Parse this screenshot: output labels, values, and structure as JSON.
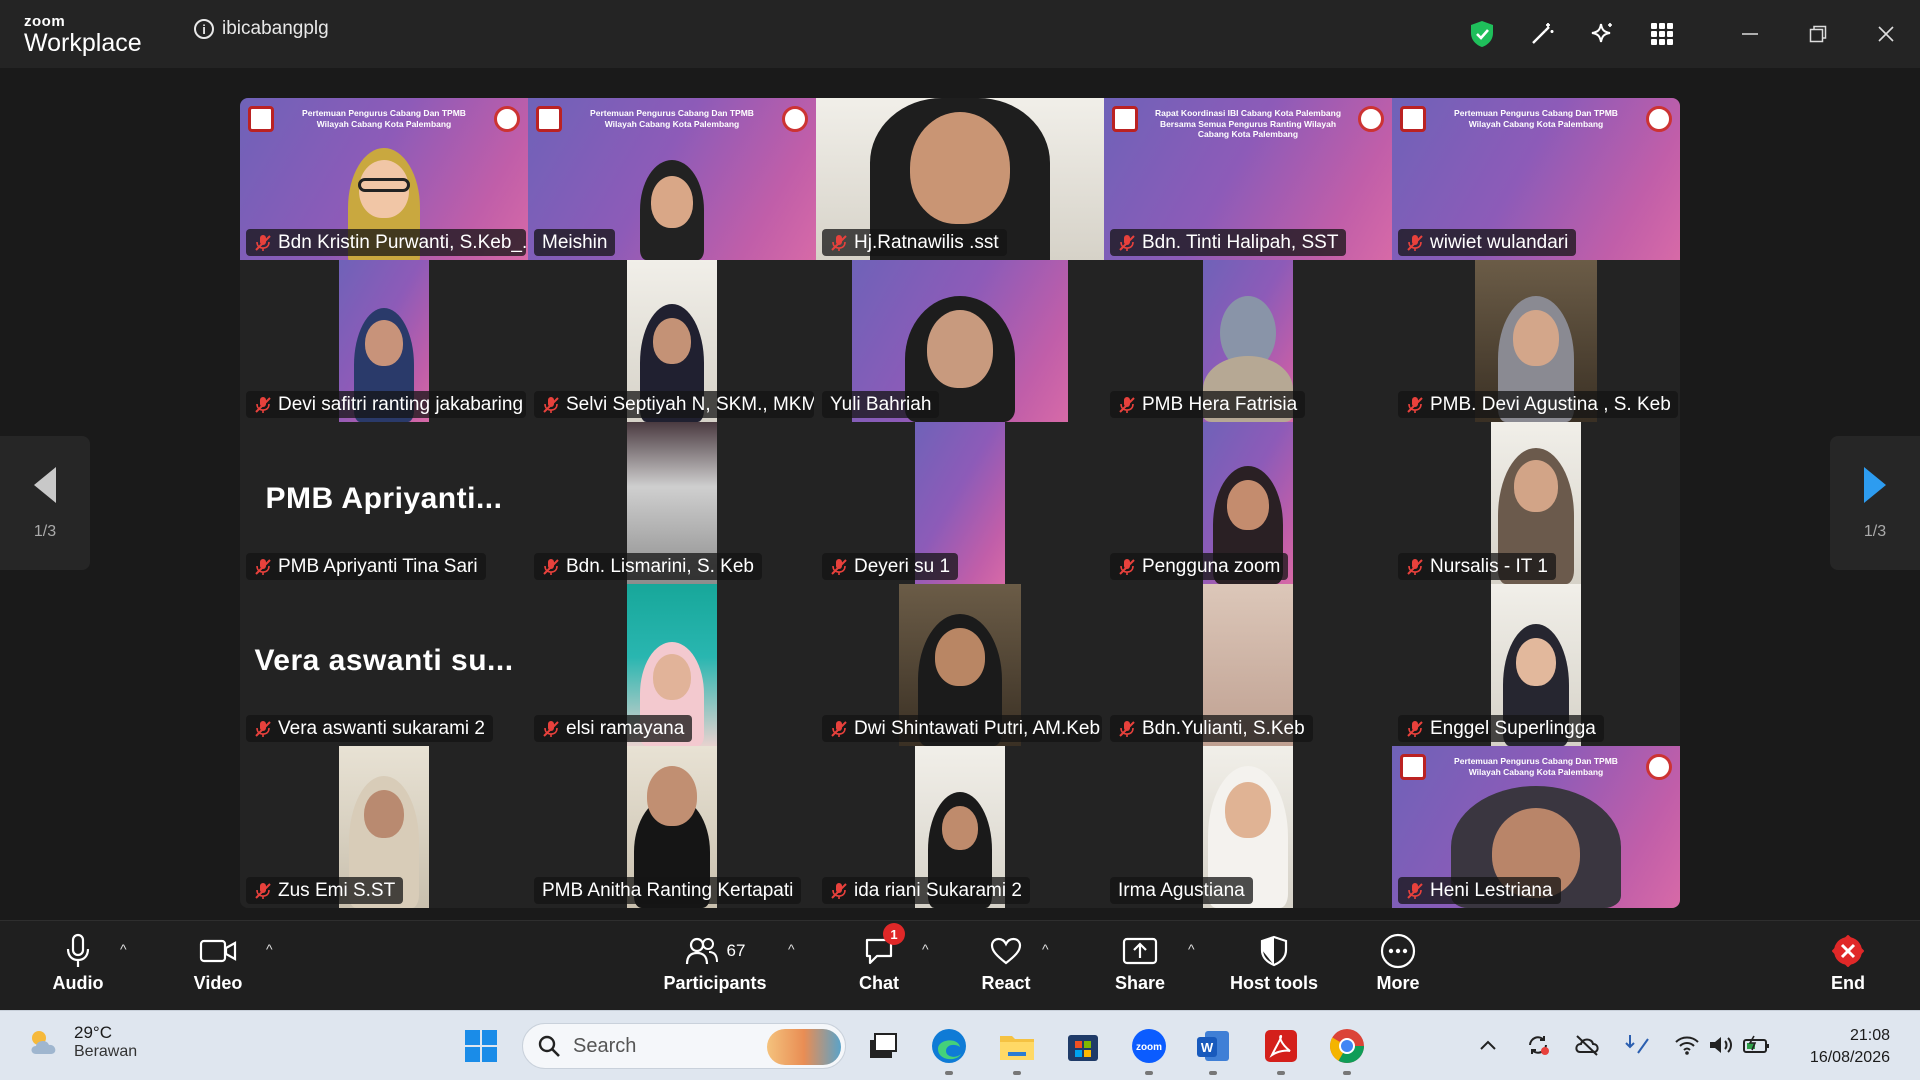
{
  "app": {
    "logo_top": "zoom",
    "logo_bottom": "Workplace",
    "meeting_name": "ibicabangplg"
  },
  "banners": {
    "pertemuan": "Pertemuan Pengurus Cabang Dan TPMB Wilayah Cabang Kota Palembang",
    "rapat": "Rapat Koordinasi IBI Cabang Kota Palembang Bersama Semua Pengurus Ranting Wilayah Cabang Kota Palembang"
  },
  "tiles": [
    {
      "name": "Bdn Kristin Purwanti, S.Keb_..."
    },
    {
      "name": "Meishin"
    },
    {
      "name": "Hj.Ratnawilis .sst"
    },
    {
      "name": "Bdn. Tinti Halipah, SST"
    },
    {
      "name": "wiwiet wulandari"
    },
    {
      "name": "Devi safitri ranting jakabaring"
    },
    {
      "name": "Selvi Septiyah N, SKM., MKM"
    },
    {
      "name": "Yuli Bahriah"
    },
    {
      "name": "PMB Hera Fatrisia"
    },
    {
      "name": "PMB. Devi Agustina , S. Keb"
    },
    {
      "name": "PMB Apriyanti Tina Sari",
      "overlay": "PMB  Apriyanti..."
    },
    {
      "name": "Bdn. Lismarini, S. Keb"
    },
    {
      "name": "Deyeri su 1"
    },
    {
      "name": "Pengguna zoom"
    },
    {
      "name": "Nursalis - IT 1"
    },
    {
      "name": "Vera aswanti sukarami 2",
      "overlay": "Vera  aswanti  su..."
    },
    {
      "name": "elsi ramayana"
    },
    {
      "name": "Dwi Shintawati Putri, AM.Keb"
    },
    {
      "name": "Bdn.Yulianti, S.Keb"
    },
    {
      "name": "Enggel Superlingga"
    },
    {
      "name": "Zus Emi S.ST"
    },
    {
      "name": "PMB Anitha Ranting Kertapati"
    },
    {
      "name": "ida riani Sukarami 2"
    },
    {
      "name": "Irma Agustiana"
    },
    {
      "name": "Heni Lestriana"
    }
  ],
  "pager": {
    "left": "1/3",
    "right": "1/3"
  },
  "toolbar": {
    "audio": "Audio",
    "video": "Video",
    "participants": "Participants",
    "participants_count": "67",
    "chat": "Chat",
    "chat_badge": "1",
    "react": "React",
    "share": "Share",
    "host_tools": "Host tools",
    "more": "More",
    "end": "End"
  },
  "taskbar": {
    "temp": "29°C",
    "weather": "Berawan",
    "search_placeholder": "Search",
    "time": "21:08",
    "date": "16/08/2026"
  }
}
